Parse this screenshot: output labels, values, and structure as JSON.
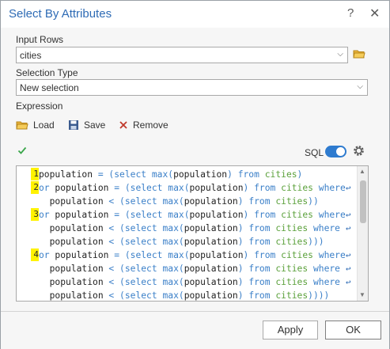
{
  "window": {
    "title": "Select By Attributes",
    "help_glyph": "?",
    "close_glyph": "✕"
  },
  "input_rows": {
    "label": "Input Rows",
    "value": "cities"
  },
  "selection_type": {
    "label": "Selection Type",
    "value": "New selection"
  },
  "expression": {
    "label": "Expression",
    "load_label": "Load",
    "save_label": "Save",
    "remove_label": "Remove",
    "sql_label": "SQL",
    "sql_mode_on": true
  },
  "code": {
    "lines": [
      {
        "number": "1",
        "text": "population = (select max(population) from cities)"
      },
      {
        "number": "2",
        "text": "or population = (select max(population) from cities where"
      },
      {
        "number": "",
        "text": "  population < (select max(population) from cities))"
      },
      {
        "number": "3",
        "text": "or population = (select max(population) from cities where"
      },
      {
        "number": "",
        "text": "  population < (select max(population) from cities where"
      },
      {
        "number": "",
        "text": "  population < (select max(population) from cities)))"
      },
      {
        "number": "4",
        "text": "or population = (select max(population) from cities where"
      },
      {
        "number": "",
        "text": "  population < (select max(population) from cities where"
      },
      {
        "number": "",
        "text": "  population < (select max(population) from cities where"
      },
      {
        "number": "",
        "text": "  population < (select max(population) from cities))))"
      }
    ]
  },
  "buttons": {
    "apply": "Apply",
    "ok": "OK"
  },
  "colors": {
    "title": "#2e6bb5",
    "accent": "#2e7bcf",
    "line_number_highlight": "#fff200",
    "keyword": "#3a7fc8",
    "table_name": "#5aa03a"
  }
}
